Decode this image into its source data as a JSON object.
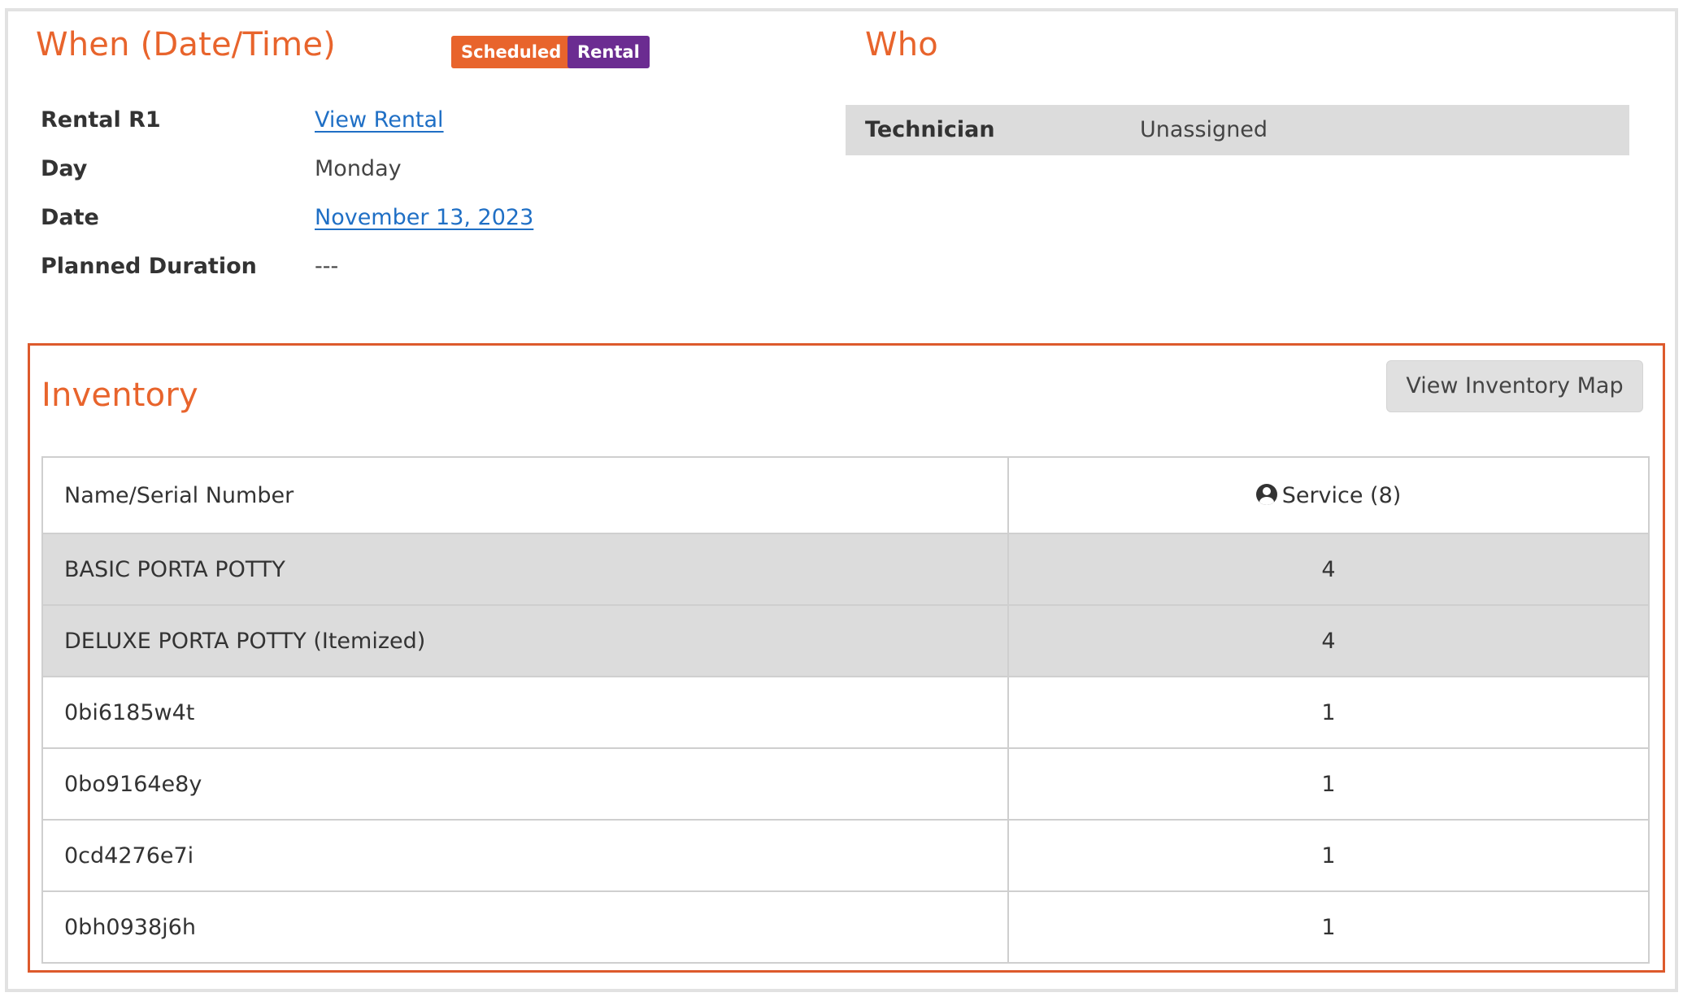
{
  "when": {
    "title": "When (Date/Time)",
    "badges": {
      "status": {
        "label": "Scheduled",
        "color": "#e8642c"
      },
      "type": {
        "label": "Rental",
        "color": "#6b2c91"
      }
    },
    "rows": [
      {
        "label": "Rental R1",
        "value": "View Rental"
      },
      {
        "label": "Day",
        "value": "Monday"
      },
      {
        "label": "Date",
        "value": "November 13, 2023"
      },
      {
        "label": "Planned Duration",
        "value": "---"
      }
    ]
  },
  "who": {
    "title": "Who",
    "technician_label": "Technician",
    "technician_value": "Unassigned"
  },
  "inventory": {
    "title": "Inventory",
    "map_button": "View Inventory Map",
    "columns": {
      "name": "Name/Serial Number",
      "service": "Service (8)",
      "service_icon": "user-circle-icon"
    },
    "rows": [
      {
        "name": "BASIC PORTA POTTY",
        "service": "4",
        "group": true
      },
      {
        "name": "DELUXE PORTA POTTY (Itemized)",
        "service": "4",
        "group": true
      },
      {
        "name": "0bi6185w4t",
        "service": "1",
        "group": false
      },
      {
        "name": "0bo9164e8y",
        "service": "1",
        "group": false
      },
      {
        "name": "0cd4276e7i",
        "service": "1",
        "group": false
      },
      {
        "name": "0bh0938j6h",
        "service": "1",
        "group": false
      }
    ]
  },
  "colors": {
    "accent": "#e8642c",
    "link": "#1f6fc5",
    "group_row_bg": "#dcdcdc"
  }
}
